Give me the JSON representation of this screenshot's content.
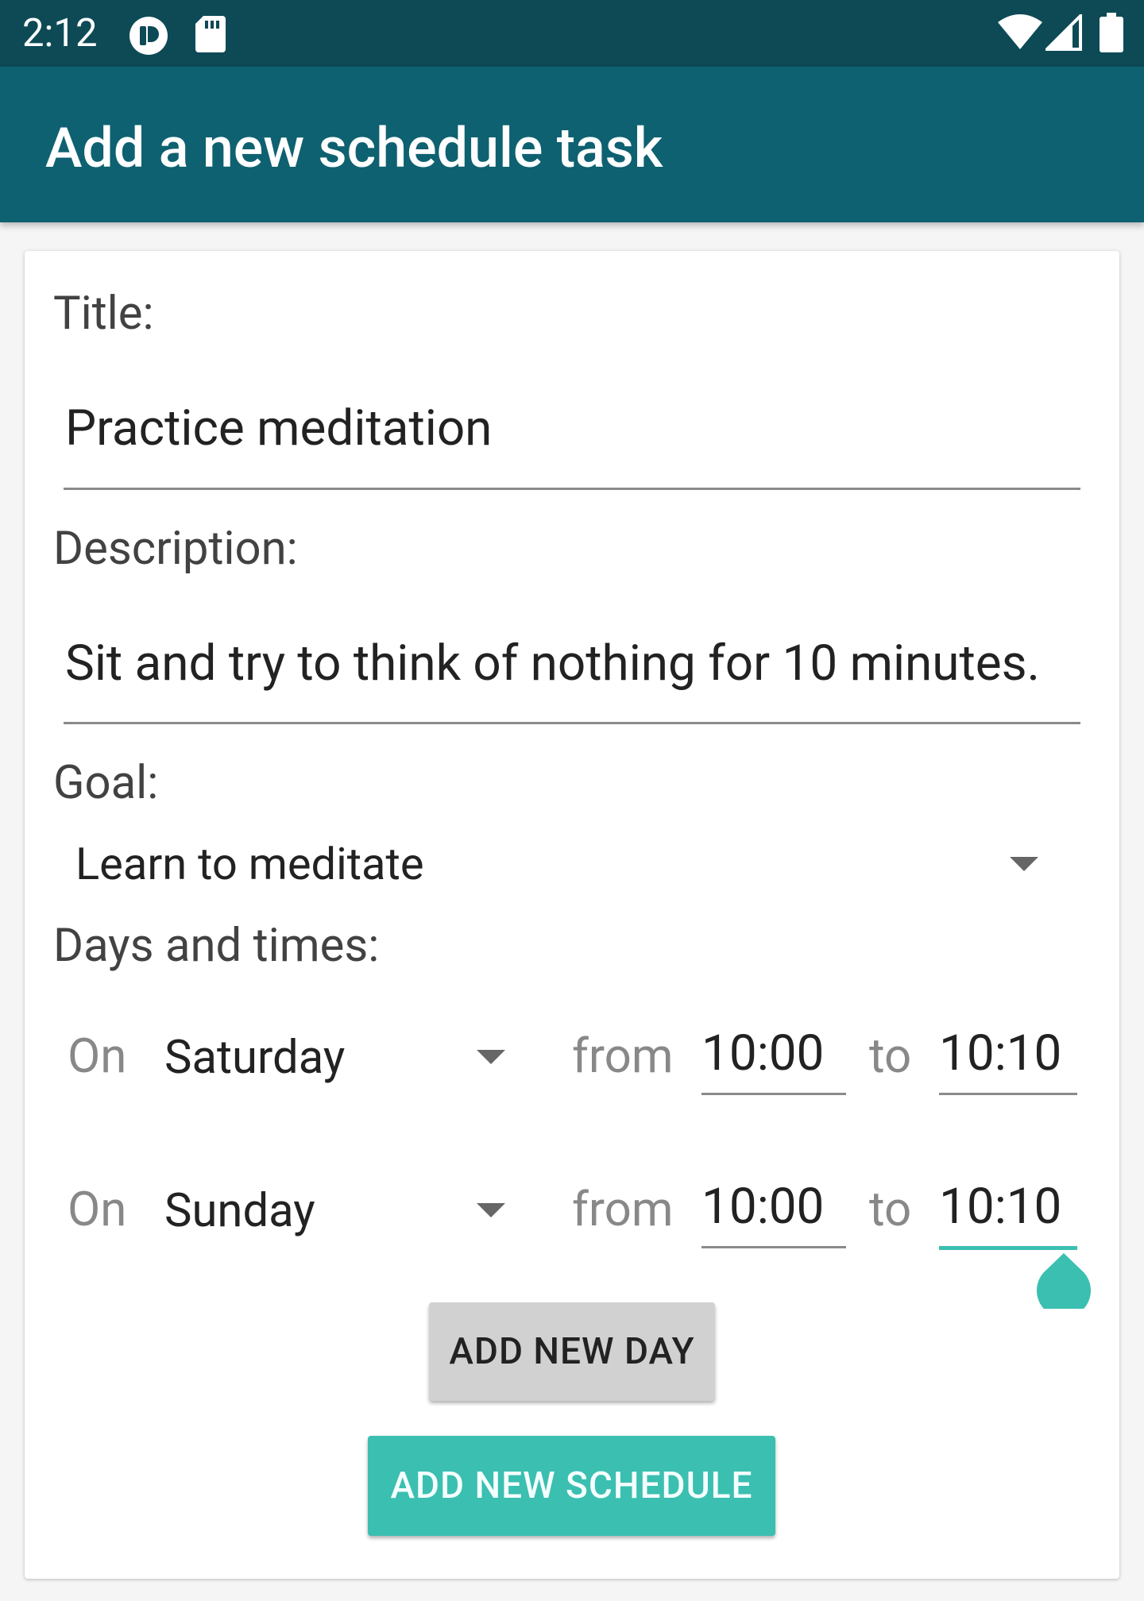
{
  "status_bar": {
    "time": "2:12",
    "icons": [
      "app-notification-icon",
      "sd-card-icon",
      "wifi-icon",
      "cell-signal-icon",
      "battery-icon"
    ]
  },
  "app_bar": {
    "title": "Add a new schedule task"
  },
  "form": {
    "title_label": "Title:",
    "title_value": "Practice meditation",
    "description_label": "Description:",
    "description_value": "Sit and try to think of nothing for 10 minutes.",
    "goal_label": "Goal:",
    "goal_value": "Learn to meditate",
    "days_label": "Days and times:",
    "schedule_rows": [
      {
        "on": "On",
        "day": "Saturday",
        "from": "from",
        "start": "10:00",
        "to": "to",
        "end": "10:10"
      },
      {
        "on": "On",
        "day": "Sunday",
        "from": "from",
        "start": "10:00",
        "to": "to",
        "end": "10:10"
      }
    ],
    "add_day_button": "ADD NEW DAY",
    "add_schedule_button": "ADD NEW SCHEDULE"
  },
  "colors": {
    "status_bar": "#0d4a56",
    "app_bar": "#0e6170",
    "accent": "#3bbfb0",
    "button_gray": "#d1d1d1"
  }
}
